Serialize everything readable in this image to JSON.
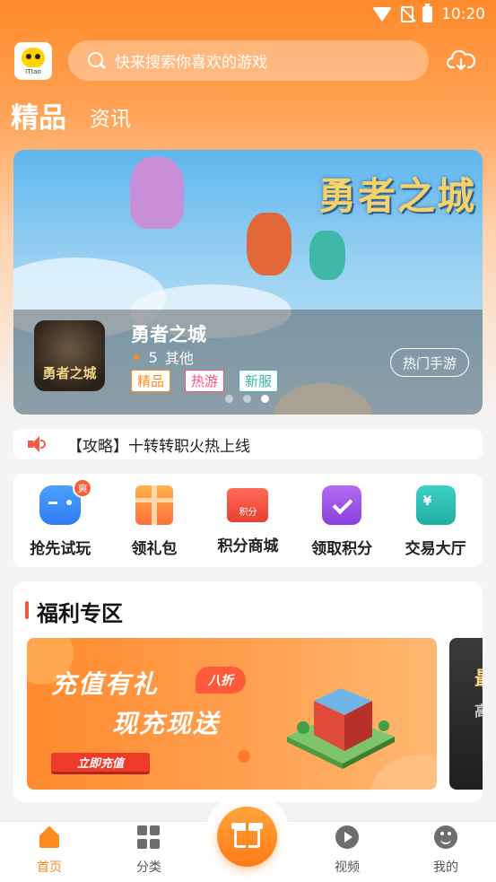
{
  "status_bar": {
    "time": "10:20"
  },
  "header": {
    "logo_text": "ITtao",
    "search_placeholder": "快来搜索你喜欢的游戏"
  },
  "tabs": [
    {
      "label": "精品",
      "active": true
    },
    {
      "label": "资讯",
      "active": false
    }
  ],
  "banner": {
    "logo_text": "勇者之城",
    "game": {
      "icon_text": "勇者之城",
      "title": "勇者之城",
      "rating": "5",
      "category": "其他",
      "tags": [
        "精品",
        "热游",
        "新服"
      ]
    },
    "hot_button": "热门手游",
    "active_dot": 3
  },
  "notice": {
    "text": "【攻略】十转转职火热上线"
  },
  "quick_menu": [
    {
      "label": "抢先试玩",
      "icon": "gamepad-icon",
      "badge": "爽"
    },
    {
      "label": "领礼包",
      "icon": "gift-icon"
    },
    {
      "label": "积分商城",
      "icon": "points-shop-icon",
      "icon_text": "积分"
    },
    {
      "label": "领取积分",
      "icon": "calendar-check-icon"
    },
    {
      "label": "交易大厅",
      "icon": "wallet-icon",
      "icon_text": "¥"
    }
  ],
  "welfare": {
    "title": "福利专区",
    "promo": {
      "line1": "充值有礼",
      "line2": "现充现送",
      "discount": "八折",
      "button": "立即充值"
    },
    "promo2_text": [
      "最",
      "高"
    ]
  },
  "bottom_nav": [
    {
      "label": "首页",
      "icon": "home-icon",
      "active": true
    },
    {
      "label": "分类",
      "icon": "grid-icon",
      "active": false
    },
    {
      "label": "视频",
      "icon": "play-icon",
      "active": false
    },
    {
      "label": "我的",
      "icon": "face-icon",
      "active": false
    }
  ],
  "colors": {
    "accent": "#ff8a1e",
    "header_gradient_top": "#ff8a2b",
    "tag_orange": "#ff8a1e",
    "tag_pink": "#ff4f80",
    "tag_teal": "#3bb6a8"
  }
}
